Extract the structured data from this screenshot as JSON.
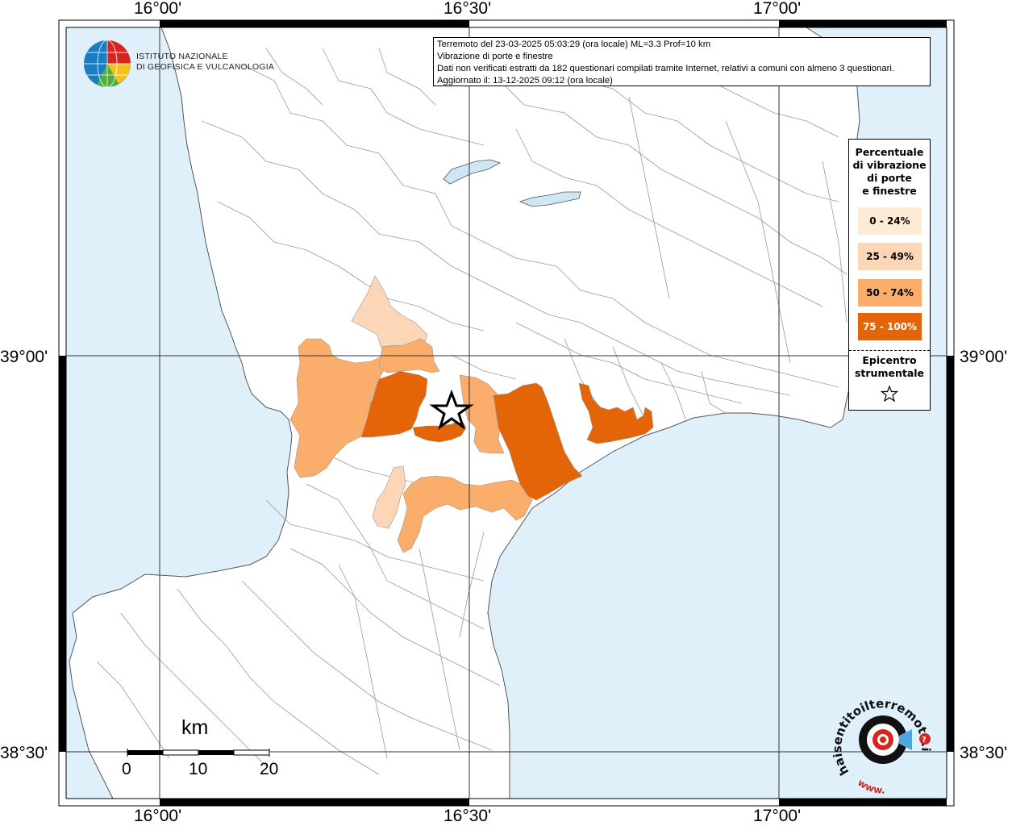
{
  "info_box": {
    "line1": "Terremoto del 23-03-2025 05:03:29 (ora locale) ML=3.3 Prof=10 km",
    "line2": "Vibrazione di porte e finestre",
    "line3": "Dati non verificati estratti da 182 questionari compilati tramite Internet, relativi a comuni con almeno 3 questionari.",
    "line4": "Aggiornato il: 13-12-2025 09:12 (ora locale)"
  },
  "coordinates": {
    "top_lon": [
      "16°00'",
      "16°30'",
      "17°00'"
    ],
    "bottom_lon": [
      "16°00'",
      "16°30'",
      "17°00'"
    ],
    "left_lat": [
      "39°00'",
      "38°30'"
    ],
    "right_lat": [
      "39°00'",
      "38°30'"
    ]
  },
  "logo": {
    "line1": "ISTITUTO NAZIONALE",
    "line2": "DI GEOFISICA E VULCANOLOGIA"
  },
  "legend": {
    "title_lines": [
      "Percentuale",
      "di vibrazione",
      "di porte",
      "e finestre"
    ],
    "classes": [
      {
        "label": "0 - 24%",
        "color": "#fdebd6",
        "text_color": "#000000"
      },
      {
        "label": "25 - 49%",
        "color": "#fcd6b6",
        "text_color": "#000000"
      },
      {
        "label": "50 - 74%",
        "color": "#fbae6b",
        "text_color": "#000000"
      },
      {
        "label": "75 - 100%",
        "color": "#e46408",
        "text_color": "#ffffff"
      }
    ],
    "epicenter_lines": [
      "Epicentro",
      "strumentale"
    ]
  },
  "scale_bar": {
    "unit": "km",
    "ticks": [
      "0",
      "10",
      "20"
    ]
  },
  "colors": {
    "sea": "#dff0fb",
    "land": "#ffffff",
    "boundary": "#9a9a9a",
    "grid": "#333333",
    "accent_red": "#d7261e"
  },
  "icons": {
    "epicenter": "star-icon",
    "logo_globe": "globe-icon",
    "hst_logo": "haisentito-logo-icon"
  },
  "hst_logo_text": {
    "main": "haisentitoilterremoto.it",
    "sub": "www."
  }
}
